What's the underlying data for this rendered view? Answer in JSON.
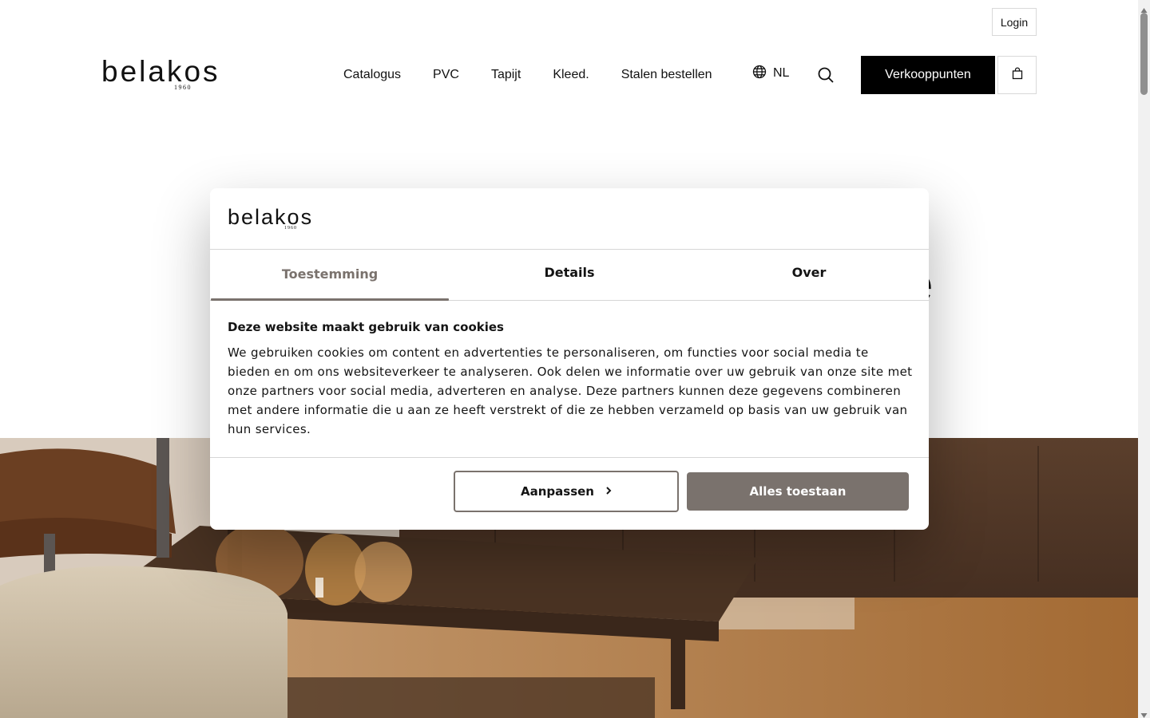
{
  "header": {
    "login_label": "Login",
    "logo_word": "belakos",
    "logo_year": "1960",
    "nav": [
      "Catalogus",
      "PVC",
      "Tapijt",
      "Kleed.",
      "Stalen bestellen"
    ],
    "language": "NL",
    "stores_label": "Verkooppunten",
    "icons": {
      "language": "globe-icon",
      "search": "search-icon",
      "cart": "shopping-bag-icon"
    }
  },
  "page": {
    "hero_heading_fragment": "e"
  },
  "cookie_dialog": {
    "logo_word": "belakos",
    "logo_year": "1960",
    "tabs": [
      "Toestemming",
      "Details",
      "Over"
    ],
    "active_tab": "Toestemming",
    "heading": "Deze website maakt gebruik van cookies",
    "body": "We gebruiken cookies om content en advertenties te personaliseren, om functies voor social media te bieden en om ons websiteverkeer te analyseren. Ook delen we informatie over uw gebruik van onze site met onze partners voor social media, adverteren en analyse. Deze partners kunnen deze gegevens combineren met andere informatie die u aan ze heeft verstrekt of die ze hebben verzameld op basis van uw gebruik van hun services.",
    "customize_label": "Aanpassen",
    "allow_all_label": "Alles toestaan",
    "accent_color": "#7a726d"
  }
}
